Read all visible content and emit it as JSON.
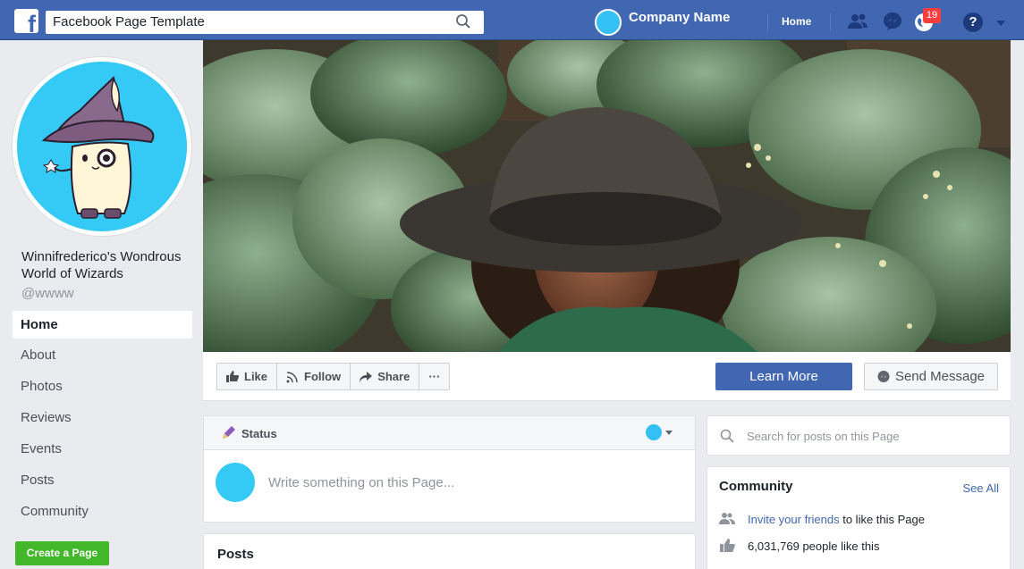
{
  "topbar": {
    "search_text": "Facebook Page Template",
    "company_name": "Company Name",
    "home_label": "Home",
    "notification_count": "19",
    "help_label": "?"
  },
  "profile": {
    "page_name": "Winnifrederico's Wondrous World of Wizards",
    "handle": "@wwww"
  },
  "nav": {
    "items": [
      {
        "label": "Home"
      },
      {
        "label": "About"
      },
      {
        "label": "Photos"
      },
      {
        "label": "Reviews"
      },
      {
        "label": "Events"
      },
      {
        "label": "Posts"
      },
      {
        "label": "Community"
      }
    ],
    "create_page_label": "Create a Page"
  },
  "actions": {
    "like_label": "Like",
    "follow_label": "Follow",
    "share_label": "Share",
    "more_label": "···",
    "learn_more_label": "Learn More",
    "send_message_label": "Send Message"
  },
  "status": {
    "label": "Status",
    "placeholder": "Write something on this Page..."
  },
  "posts": {
    "title": "Posts"
  },
  "search_posts": {
    "placeholder": "Search for posts on this Page"
  },
  "community": {
    "title": "Community",
    "see_all": "See All",
    "invite_link": "Invite your friends",
    "invite_rest": " to like this Page",
    "likes_text": "6,031,769 people like this"
  },
  "colors": {
    "brand": "#4267b2",
    "accent_avatar": "#35c0f5",
    "create_button": "#42b72a",
    "badge": "#fa3e3e"
  }
}
